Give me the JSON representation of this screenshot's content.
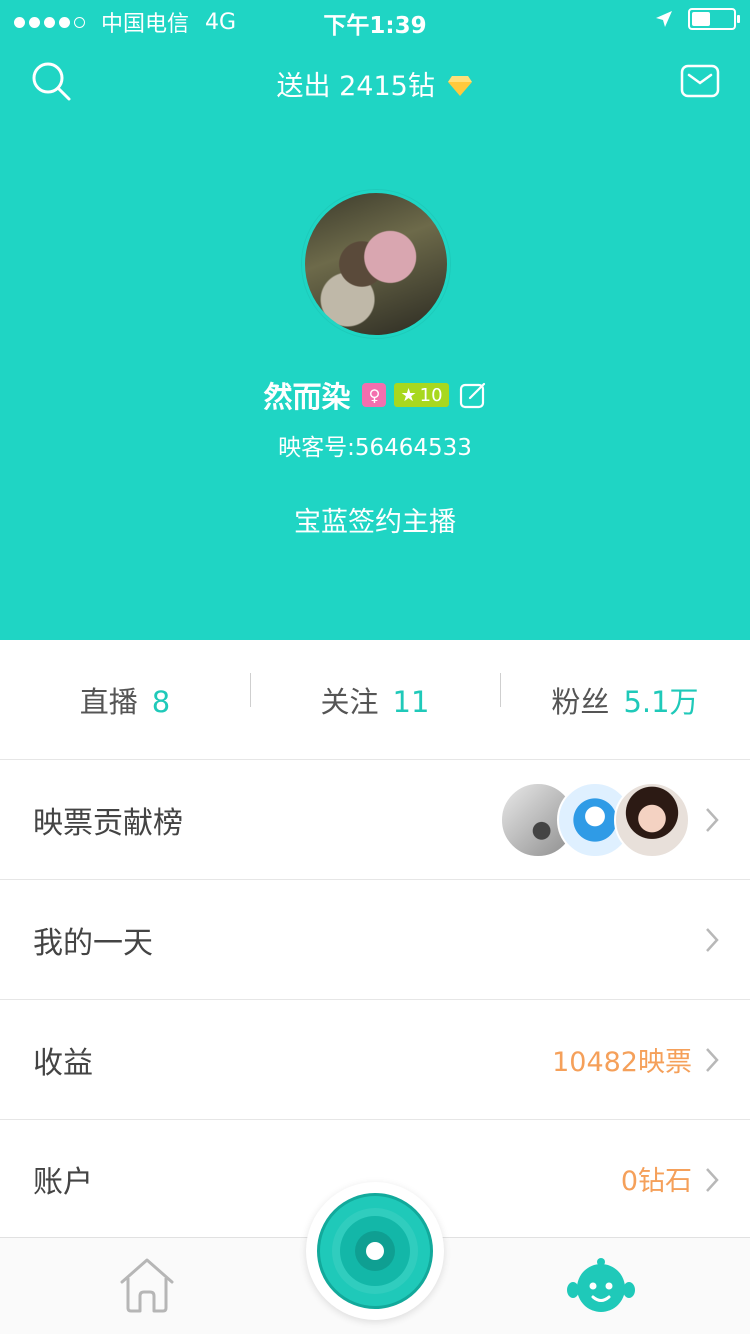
{
  "status_bar": {
    "carrier": "中国电信",
    "network": "4G",
    "time": "下午1:39",
    "battery_level": 0.4
  },
  "topbar": {
    "title": "送出 2415钻",
    "icons": [
      "search-icon",
      "diamond-icon",
      "mail-icon"
    ]
  },
  "profile": {
    "name": "然而染",
    "level": "10",
    "id_text": "映客号:56464533",
    "signature": "宝蓝签约主播"
  },
  "stats": [
    {
      "label": "直播",
      "value": "8"
    },
    {
      "label": "关注",
      "value": "11"
    },
    {
      "label": "粉丝",
      "value": "5.1万"
    }
  ],
  "rows": [
    {
      "label": "映票贡献榜",
      "value": ""
    },
    {
      "label": "我的一天",
      "value": ""
    },
    {
      "label": "收益",
      "value": "10482映票"
    },
    {
      "label": "账户",
      "value": "0钻石"
    }
  ],
  "colors": {
    "accent": "#1fd5c4",
    "value_orange": "#f5a05a",
    "stat_teal": "#1fc9b9"
  },
  "tabbar": {
    "icons": [
      "home-icon",
      "live-icon",
      "profile-icon"
    ]
  }
}
